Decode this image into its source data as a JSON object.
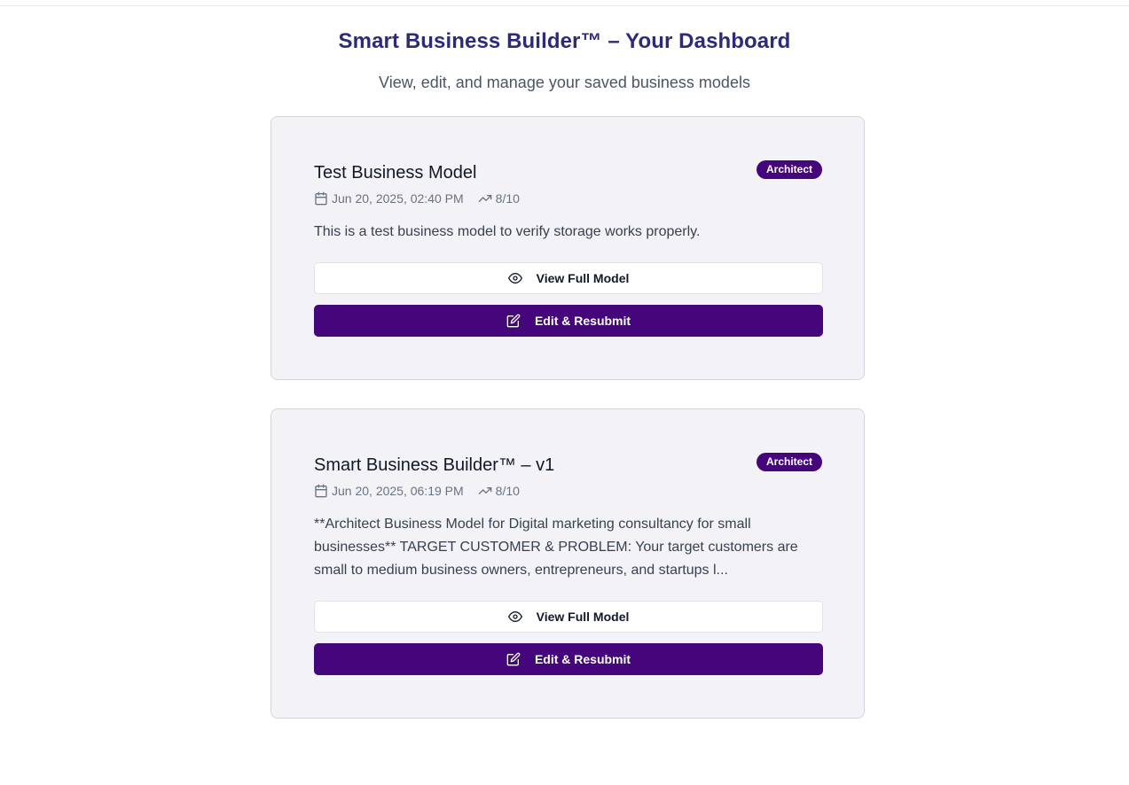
{
  "header": {
    "title": "Smart Business Builder™ – Your Dashboard",
    "subtitle": "View, edit, and manage your saved business models"
  },
  "models": [
    {
      "title": "Test Business Model",
      "badge": "Architect",
      "date": "Jun 20, 2025, 02:40 PM",
      "score": "8/10",
      "description": "This is a test business model to verify storage works properly.",
      "view_label": "View Full Model",
      "edit_label": "Edit & Resubmit"
    },
    {
      "title": "Smart Business Builder™ – v1",
      "badge": "Architect",
      "date": "Jun 20, 2025, 06:19 PM",
      "score": "8/10",
      "description": "**Architect Business Model for Digital marketing consultancy for small businesses** TARGET CUSTOMER & PROBLEM: Your target customers are small to medium business owners, entrepreneurs, and startups l...",
      "view_label": "View Full Model",
      "edit_label": "Edit & Resubmit"
    }
  ],
  "icons": {
    "date": "calendar-icon",
    "score": "trending-up-icon",
    "view": "eye-icon",
    "edit": "edit-icon"
  },
  "colors": {
    "title": "#2e2a7a",
    "accent": "#44067a",
    "card_bg": "#f3f2f7"
  }
}
